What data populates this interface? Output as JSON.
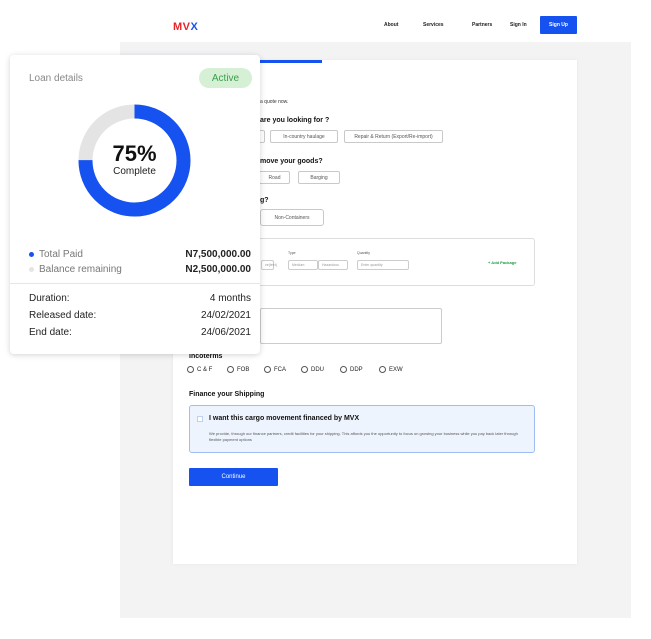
{
  "nav": {
    "logo_main": "MV",
    "logo_accent": "X",
    "links": [
      "About",
      "Services",
      "Partners",
      "Sign In"
    ],
    "signup": "Sign Up"
  },
  "form": {
    "intro": "a quote now.",
    "q_service": "are you looking for ?",
    "service_options": [
      "In-country haulage",
      "Repair & Return (Export/Re-import)"
    ],
    "q_move": "move your goods?",
    "move_options": [
      "Road",
      "Barging"
    ],
    "q_cargo": "g?",
    "cargo_options": [
      "Non-Containers"
    ],
    "package": {
      "type_label": "Type",
      "type_options": [
        "Medium",
        "Hazardous"
      ],
      "qty_label": "Quantity",
      "qty_placeholder": "Enter quantity",
      "first_placeholder": "ze(feet)",
      "add": "+ Add Package"
    },
    "incoterms_title": "Incoterms",
    "incoterms": [
      "C & F",
      "FOB",
      "FCA",
      "DDU",
      "DDP",
      "EXW"
    ],
    "finance_title": "Finance your Shipping",
    "finance_check": "I want this cargo movement financed by MVX",
    "finance_desc": "We provide, through our finance partners, credit facilities for your shipping. This affords you the opportunity to focus on growing your business while you pay back later through flexible payment options",
    "continue": "Continue"
  },
  "loan": {
    "title": "Loan details",
    "status": "Active",
    "percent_complete": 75,
    "percent_text": "75%",
    "complete_label": "Complete",
    "legend": [
      {
        "label": "Total Paid",
        "amount": "N7,500,000.00",
        "color": "#1652f0"
      },
      {
        "label": "Balance remaining",
        "amount": "N2,500,000.00",
        "color": "#e4e4e4"
      }
    ],
    "details": [
      {
        "key": "Duration:",
        "value": "4 months"
      },
      {
        "key": "Released date:",
        "value": "24/02/2021"
      },
      {
        "key": "End date:",
        "value": "24/06/2021"
      }
    ]
  },
  "colors": {
    "accent": "#1652f0",
    "active_bg": "#d6f0d6",
    "active_text": "#3aa04a",
    "track": "#e4e4e4"
  }
}
